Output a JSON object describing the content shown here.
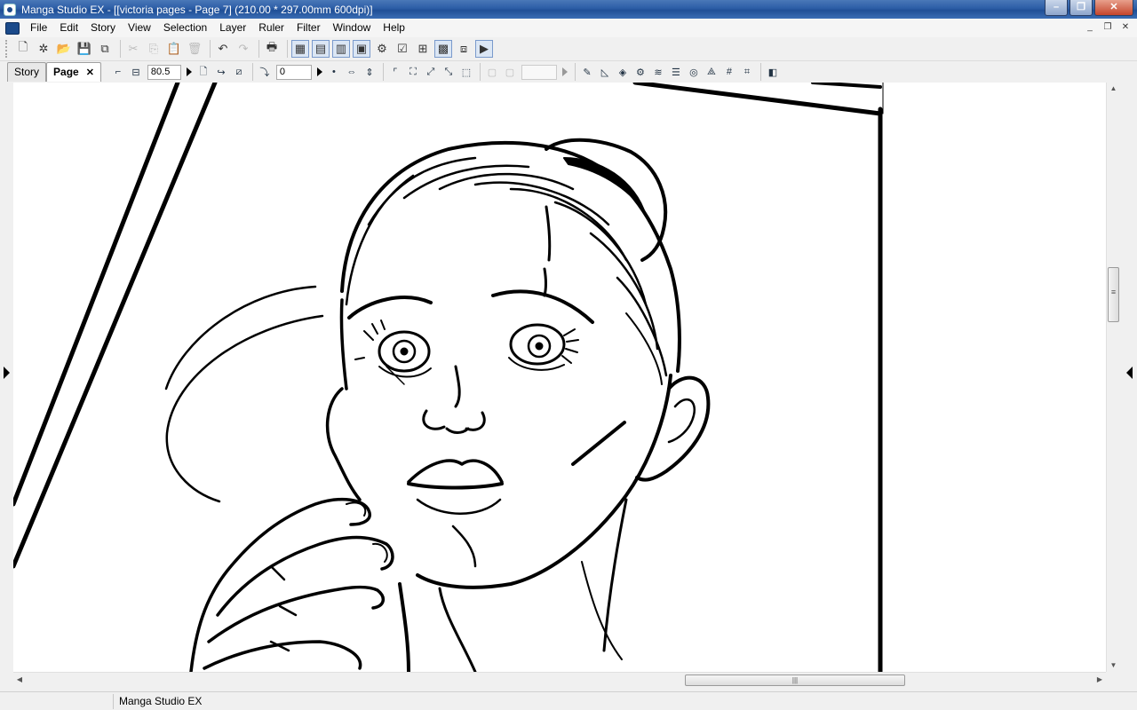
{
  "window": {
    "title": "Manga Studio EX - [[victoria pages - Page 7] (210.00 * 297.00mm 600dpi)]",
    "controls": [
      "minimize",
      "maximize",
      "close"
    ]
  },
  "menu": {
    "items": [
      "File",
      "Edit",
      "Story",
      "View",
      "Selection",
      "Layer",
      "Ruler",
      "Filter",
      "Window",
      "Help"
    ]
  },
  "toolbar": {
    "buttons": [
      "new-page-icon",
      "new-story-icon",
      "open-icon",
      "save-icon",
      "save-all-icon",
      "cut-icon",
      "copy-icon",
      "paste-icon",
      "delete-icon",
      "undo-icon",
      "redo-icon",
      "print-icon",
      "layer-view-icon",
      "page-view-icon",
      "story-view-icon",
      "preview-icon",
      "filter-icon",
      "ruler-icon",
      "grid-icon",
      "color-icon",
      "layer-icon",
      "display-icon"
    ]
  },
  "tabs": {
    "story": "Story",
    "page": "Page",
    "close": "✕"
  },
  "view_controls": {
    "zoom_value": "80.5",
    "rotation_value": "0"
  },
  "status": {
    "app_name": "Manga Studio EX"
  },
  "scrollbar": {
    "h_thumb_grip": "|||",
    "v_thumb_grip": "≡"
  }
}
